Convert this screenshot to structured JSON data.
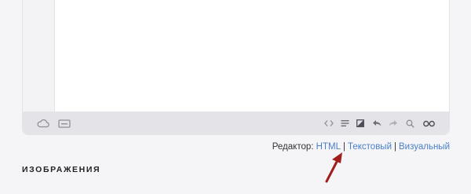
{
  "editor": {
    "toolbar_left": [
      {
        "icon": "cloud-icon",
        "name": "cloud-upload-button"
      },
      {
        "icon": "keyboard-icon",
        "name": "shortcode-button"
      }
    ],
    "toolbar_right": [
      {
        "icon": "code-icon",
        "name": "code-button"
      },
      {
        "icon": "align-icon",
        "name": "format-button"
      },
      {
        "icon": "contrast-icon",
        "name": "theme-button"
      },
      {
        "icon": "undo-icon",
        "name": "undo-button"
      },
      {
        "icon": "redo-icon",
        "name": "redo-button"
      },
      {
        "icon": "search-icon",
        "name": "search-button"
      },
      {
        "icon": "preview-icon",
        "name": "preview-button"
      }
    ]
  },
  "mode_switch": {
    "label": "Редактор:",
    "separator": "|",
    "options": [
      "HTML",
      "Текстовый",
      "Визуальный"
    ]
  },
  "section": {
    "title": "ИЗОБРАЖЕНИЯ"
  },
  "colors": {
    "link": "#4a7fc9",
    "arrow": "#a11e1e",
    "toolbar": "#e4e4e8",
    "icon": "#8e8e98"
  }
}
